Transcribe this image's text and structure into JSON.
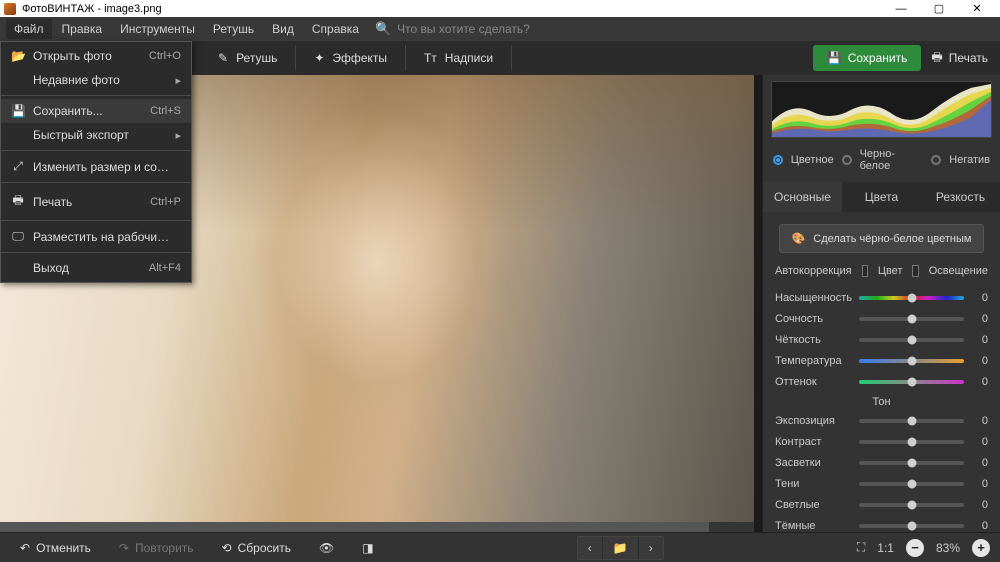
{
  "window": {
    "title": "ФотоВИНТАЖ - image3.png"
  },
  "menubar": {
    "items": [
      "Файл",
      "Правка",
      "Инструменты",
      "Ретушь",
      "Вид",
      "Справка"
    ],
    "search_placeholder": "Что вы хотите сделать?"
  },
  "dropdown": {
    "items": [
      {
        "icon": "folder-open-icon",
        "label": "Открыть фото",
        "shortcut": "Ctrl+O",
        "sep_after": false
      },
      {
        "icon": "",
        "label": "Недавние фото",
        "shortcut": "▸",
        "sep_after": true
      },
      {
        "icon": "save-icon",
        "label": "Сохранить...",
        "shortcut": "Ctrl+S",
        "selected": true
      },
      {
        "icon": "",
        "label": "Быстрый экспорт",
        "shortcut": "▸",
        "sep_after": true
      },
      {
        "icon": "resize-icon",
        "label": "Изменить размер и сохранить...",
        "shortcut": "",
        "sep_after": true
      },
      {
        "icon": "print-icon",
        "label": "Печать",
        "shortcut": "Ctrl+P",
        "sep_after": true
      },
      {
        "icon": "desktop-icon",
        "label": "Разместить на рабочий стол",
        "shortcut": "",
        "sep_after": true
      },
      {
        "icon": "",
        "label": "Выход",
        "shortcut": "Alt+F4"
      }
    ]
  },
  "tooltabs": {
    "retouch": "Ретушь",
    "effects": "Эффекты",
    "captions": "Надписи",
    "save": "Сохранить",
    "print": "Печать"
  },
  "color_mode": {
    "color": "Цветное",
    "bw": "Черно-белое",
    "negative": "Негатив"
  },
  "right_tabs": {
    "basic": "Основные",
    "colors": "Цвета",
    "sharp": "Резкость"
  },
  "bw_colorize": "Сделать чёрно-белое цветным",
  "checks": {
    "auto": "Автокоррекция",
    "color": "Цвет",
    "light": "Освещение"
  },
  "sliders": {
    "saturation": {
      "label": "Насыщенность",
      "value": "0"
    },
    "vibrance": {
      "label": "Сочность",
      "value": "0"
    },
    "clarity": {
      "label": "Чёткость",
      "value": "0"
    },
    "temperature": {
      "label": "Температура",
      "value": "0"
    },
    "tint": {
      "label": "Оттенок",
      "value": "0"
    },
    "tone_header": "Тон",
    "exposure": {
      "label": "Экспозиция",
      "value": "0"
    },
    "contrast": {
      "label": "Контраст",
      "value": "0"
    },
    "highlights": {
      "label": "Засветки",
      "value": "0"
    },
    "shadows": {
      "label": "Тени",
      "value": "0"
    },
    "whites": {
      "label": "Светлые",
      "value": "0"
    },
    "blacks": {
      "label": "Тёмные",
      "value": "0"
    }
  },
  "bottom": {
    "undo": "Отменить",
    "redo": "Повторить",
    "reset": "Сбросить",
    "fit": "1:1",
    "zoom": "83%"
  }
}
